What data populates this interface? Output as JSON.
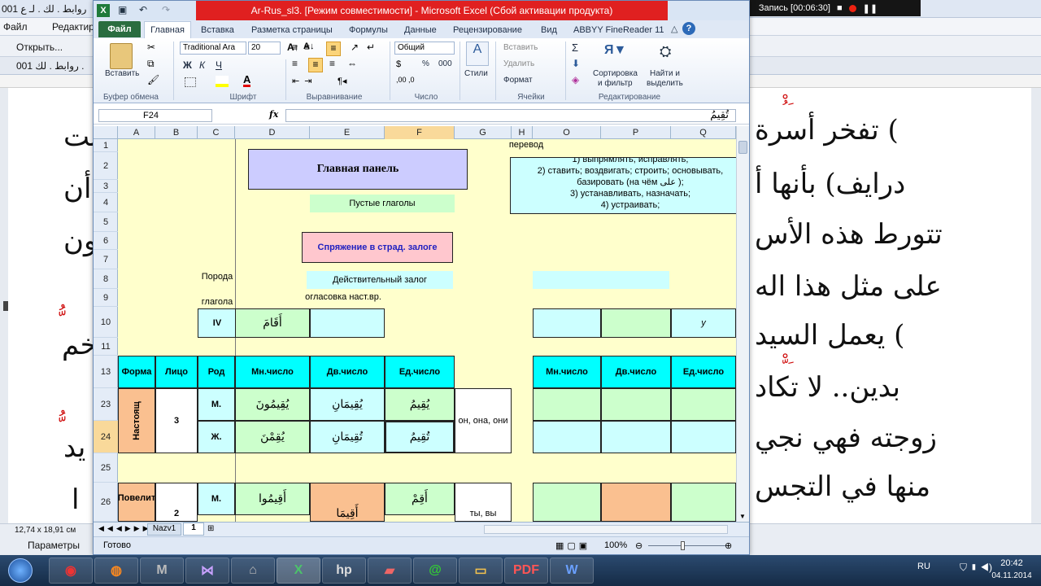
{
  "recorder": {
    "size": "1366x768",
    "label": "Запись [00:06:30]"
  },
  "background_app": {
    "menu": {
      "open": "Открыть...",
      "edit": "Редактир"
    },
    "tab_label": "001 روابط . لك . لـ ع",
    "tab_label2": "001 روابط . لك .",
    "status_size": "12,74 x 18,91 см",
    "params": "Параметры",
    "arabic_lines": [
      "تفخر أسرة (",
      "درايف) بأنها أ",
      "تتورط هذه الأس",
      "على مثل هذا اله",
      "يعمل السيد (",
      "بدين.. لا تكاد ",
      "زوجته فهي نجي",
      "منها في التجس"
    ],
    "left_fragments": [
      "نت",
      "أن",
      "ون",
      "خم",
      "يد",
      "ا"
    ]
  },
  "excel": {
    "title": "Ar-Rus_sl3. [Режим совместимости] - Microsoft Excel (Сбой активации продукта)",
    "tabs": {
      "file": "Файл",
      "home": "Главная",
      "insert": "Вставка",
      "layout": "Разметка страницы",
      "formulas": "Формулы",
      "data": "Данные",
      "review": "Рецензирование",
      "view": "Вид",
      "abbyy": "ABBYY FineReader 11"
    },
    "ribbon": {
      "paste": "Вставить",
      "clipboard": "Буфер обмена",
      "font_name": "Traditional Ara",
      "font_size": "20",
      "bold": "Ж",
      "italic": "К",
      "underline": "Ч",
      "font_group": "Шрифт",
      "align_group": "Выравнивание",
      "number_format": "Общий",
      "percent": "%",
      "thousands": "000",
      "number_group": "Число",
      "styles": "Стили",
      "insert_cells": "Вставить",
      "delete_cells": "Удалить",
      "format_cells": "Формат",
      "cells_group": "Ячейки",
      "sigma": "Σ",
      "sort_label1": "Сортировка",
      "sort_label2": "и фильтр",
      "find_label1": "Найти и",
      "find_label2": "выделить",
      "edit_group": "Редактирование"
    },
    "name_box": "F24",
    "fx": "fx",
    "formula_value": "تُقِيمُ",
    "columns": [
      "A",
      "B",
      "C",
      "D",
      "E",
      "F",
      "G",
      "H",
      "O",
      "P",
      "Q"
    ],
    "rows": [
      "1",
      "2",
      "3",
      "4",
      "5",
      "6",
      "7",
      "8",
      "9",
      "10",
      "11",
      "13",
      "23",
      "24",
      "25",
      "26"
    ],
    "cells": {
      "main_panel": "Главная панель",
      "translation_header": "перевод",
      "translation_lines": [
        "1) выпрямлять, исправлять;",
        "2) ставить; воздвигать; строить; основывать,",
        "базировать (на чём على );",
        "3) устанавливать, назначать;",
        "4) устраивать;"
      ],
      "empty_verbs": "Пустые глаголы",
      "passive_btn": "Спряжение в страд. залоге",
      "poroda": "Порода",
      "active_voice": "Действительный залог",
      "glagola": "глагола",
      "vocalization": "огласовка наст.вр.",
      "iv": "IV",
      "verb": "أَقَامَ",
      "q10": "у",
      "h_form": "Форма",
      "h_person": "Лицо",
      "h_gender": "Род",
      "h_plural": "Мн.число",
      "h_dual": "Дв.число",
      "h_singular": "Ед.число",
      "present": "Настоящ",
      "three": "3",
      "m": "М.",
      "f": "Ж.",
      "d23": "يُقِيمُونَ",
      "e23": "يُقِيمَانِ",
      "f23": "يُقِيمُ",
      "d24": "يُقِمْنَ",
      "e24": "تُقِيمَانِ",
      "f24": "تُقِيمُ",
      "g23": "он, она, они",
      "imperative": "Повелит",
      "two": "2",
      "d26": "أَقِيمُوا",
      "e26": "أَقِيمَا",
      "f26": "أَقِمْ",
      "g26": "ты, вы"
    },
    "sheet_tabs": [
      "Nazv1",
      "1"
    ],
    "status": "Готово",
    "zoom": "100%"
  },
  "taskbar": {
    "lang": "RU",
    "time": "20:42",
    "date": "04.11.2014"
  }
}
